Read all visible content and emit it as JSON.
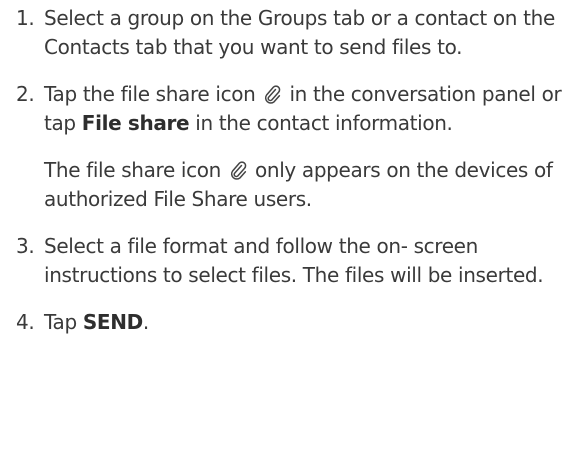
{
  "steps": [
    {
      "number": "1.",
      "text": "Select a group on the Groups tab or a contact on the Contacts tab that you want to send files to."
    },
    {
      "number": "2.",
      "text_before_icon": "Tap the file share icon",
      "text_after_icon": "in the conversation panel or tap",
      "bold": "File share",
      "text_end": "in the contact information.",
      "note_before_icon": "The file share icon",
      "note_after_icon": "only appears on the devices of authorized File Share users."
    },
    {
      "number": "3.",
      "text": "Select a file format and follow the on- screen instructions to select files. The files will be inserted."
    },
    {
      "number": "4.",
      "text_before": "Tap",
      "bold": "SEND",
      "text_after": "."
    }
  ],
  "icons": {
    "file_share": "paperclip-icon"
  }
}
